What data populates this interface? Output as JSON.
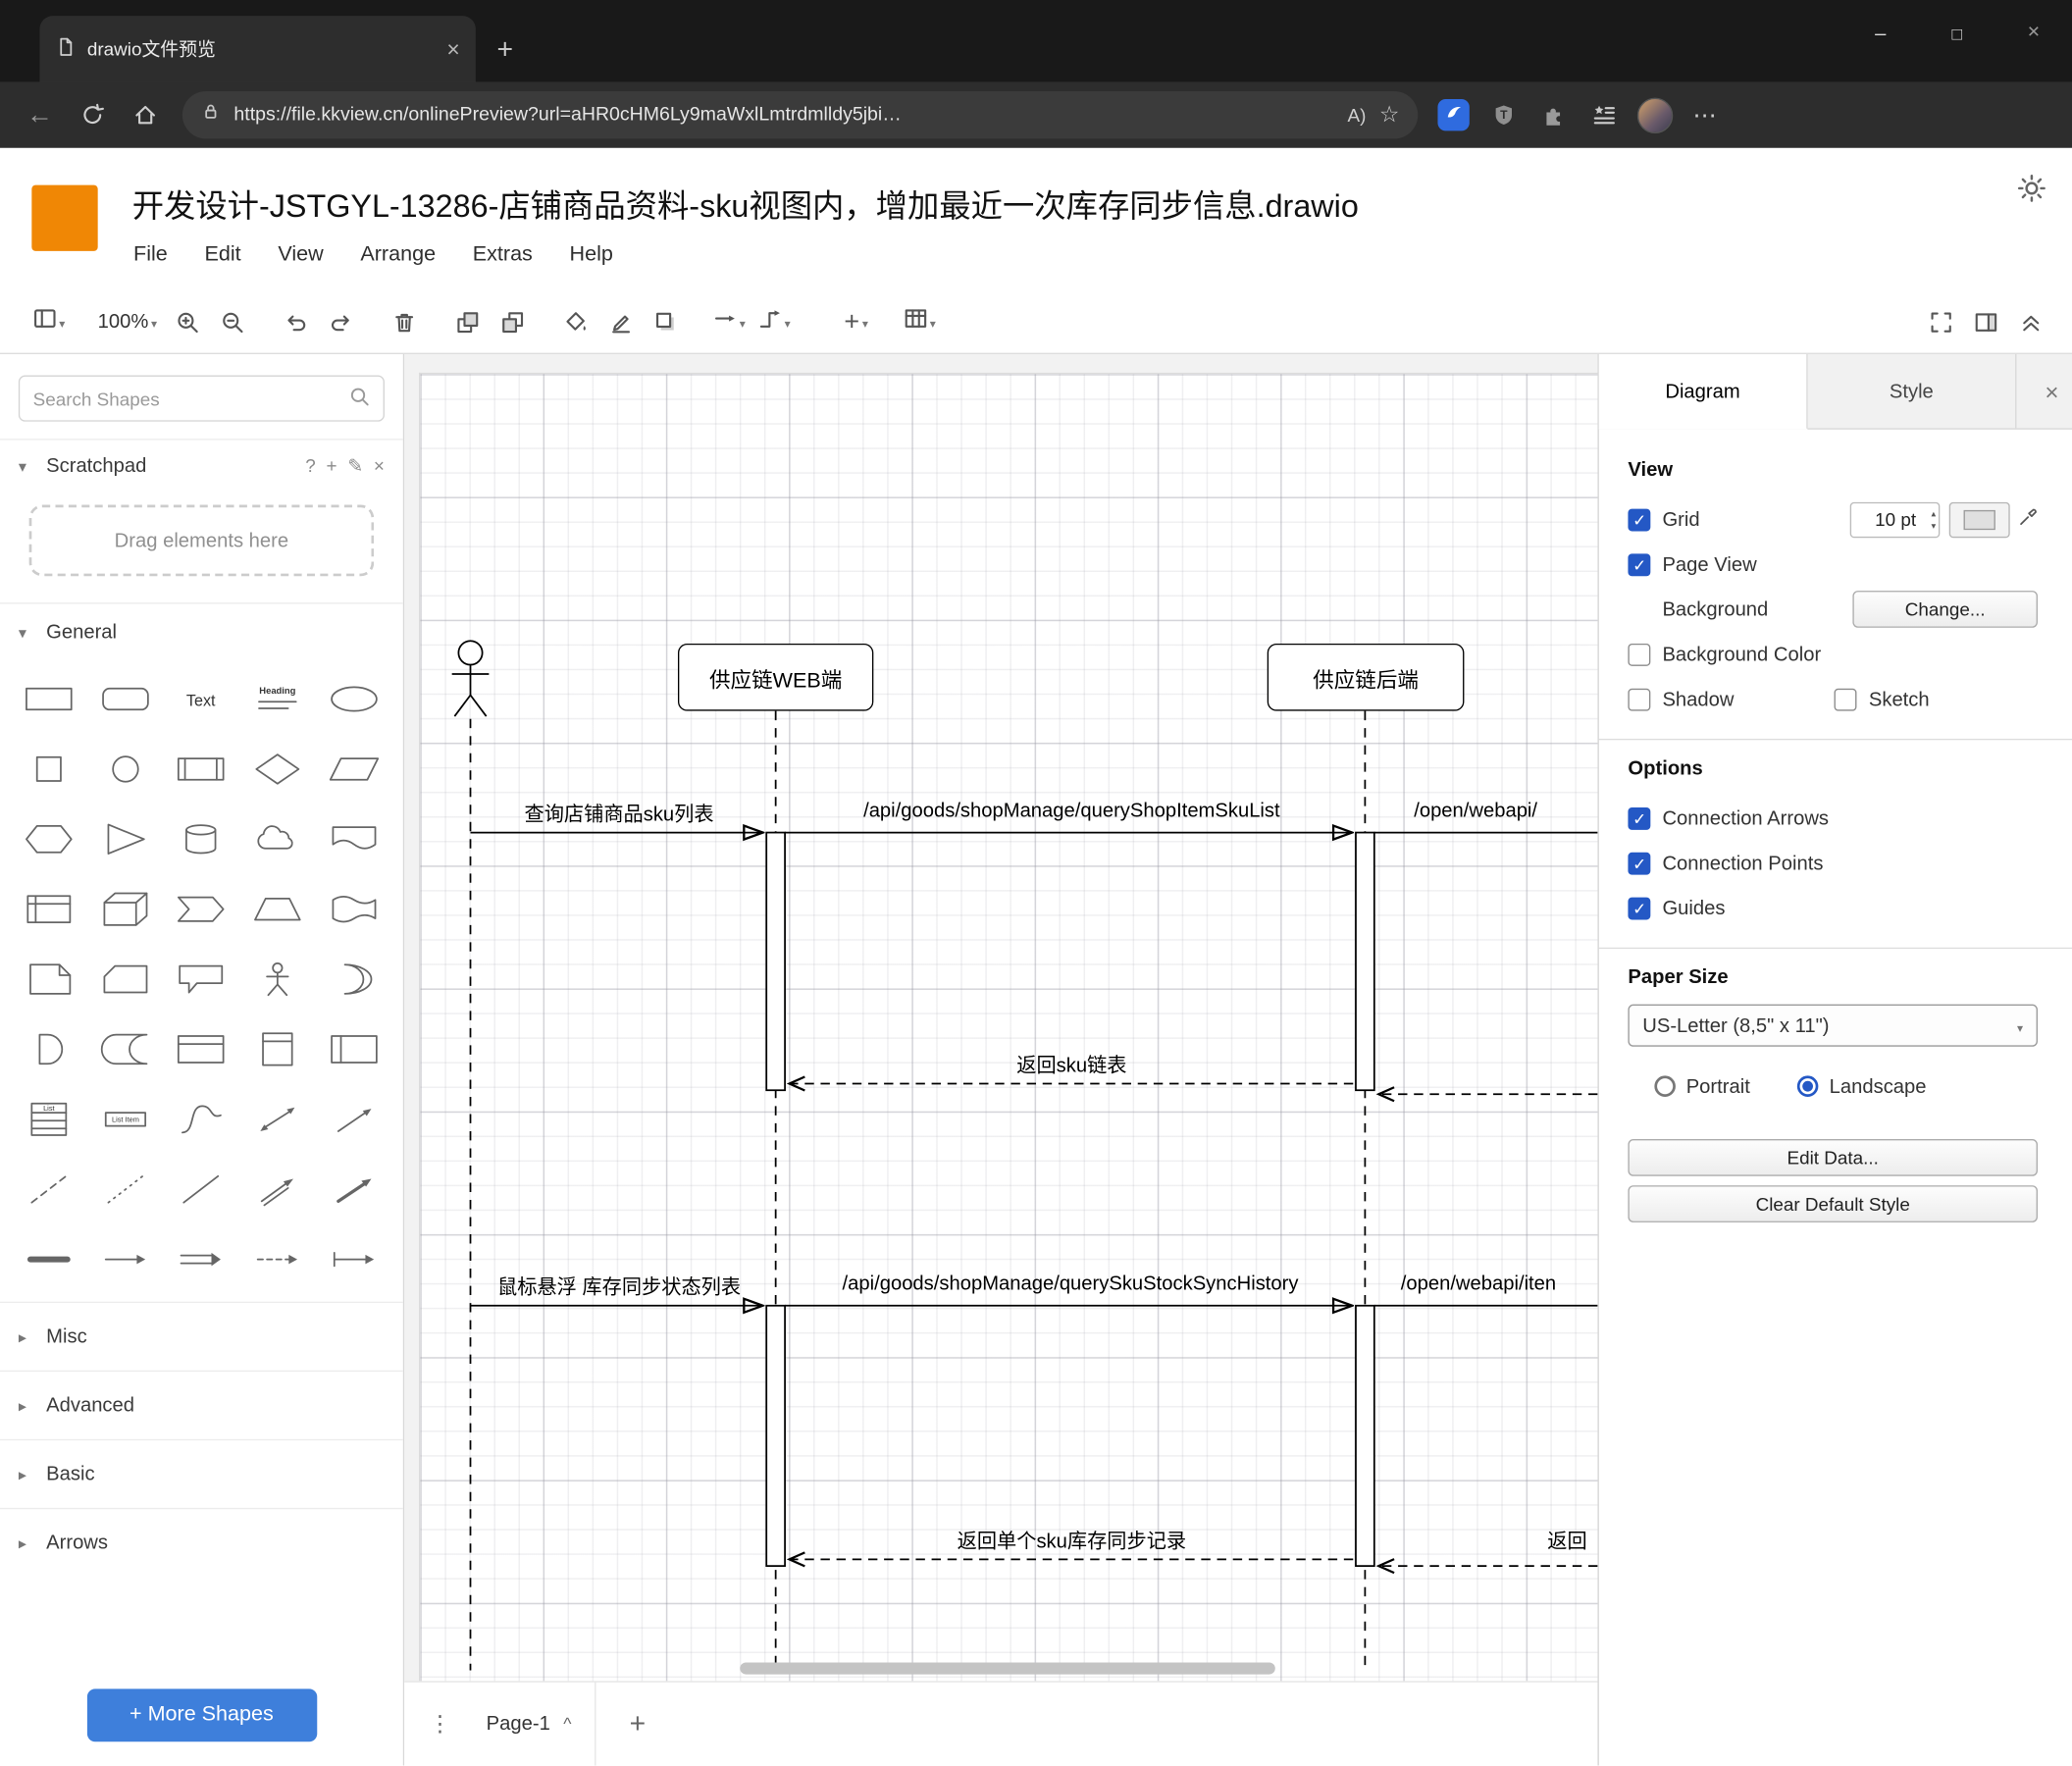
{
  "colors": {
    "drawio_orange": "#F08705",
    "more_shapes_blue": "#3E7FDB",
    "checkbox_blue": "#2458C5"
  },
  "browser": {
    "tab": {
      "title": "drawio文件预览"
    },
    "nav": {
      "url": "https://file.kkview.cn/onlinePreview?url=aHR0cHM6Ly9maWxlLmtrdmlldy5jbi…",
      "reader_label": "A)"
    }
  },
  "app": {
    "title": "开发设计-JSTGYL-13286-店铺商品资料-sku视图内，增加最近一次库存同步信息.drawio",
    "menus": [
      "File",
      "Edit",
      "View",
      "Arrange",
      "Extras",
      "Help"
    ],
    "toolbar": {
      "zoom": "100%"
    }
  },
  "sidebar": {
    "search_placeholder": "Search Shapes",
    "scratchpad_title": "Scratchpad",
    "scratchpad_hint": "Drag elements here",
    "sections": {
      "general": "General",
      "misc": "Misc",
      "advanced": "Advanced",
      "basic": "Basic",
      "arrows": "Arrows"
    },
    "more_shapes_label": "+ More Shapes",
    "shapes": [
      {
        "icon": "rectangle"
      },
      {
        "icon": "rounded-rectangle"
      },
      {
        "icon": "text",
        "label": "Text"
      },
      {
        "icon": "heading",
        "label": "Heading"
      },
      {
        "icon": "ellipse"
      },
      {
        "icon": "square"
      },
      {
        "icon": "circle"
      },
      {
        "icon": "process"
      },
      {
        "icon": "diamond"
      },
      {
        "icon": "parallelogram"
      },
      {
        "icon": "hexagon"
      },
      {
        "icon": "triangle"
      },
      {
        "icon": "cylinder"
      },
      {
        "icon": "cloud"
      },
      {
        "icon": "document"
      },
      {
        "icon": "internal-storage"
      },
      {
        "icon": "cube"
      },
      {
        "icon": "step"
      },
      {
        "icon": "trapezoid"
      },
      {
        "icon": "tape"
      },
      {
        "icon": "note"
      },
      {
        "icon": "card"
      },
      {
        "icon": "callout"
      },
      {
        "icon": "actor"
      },
      {
        "icon": "or"
      },
      {
        "icon": "and"
      },
      {
        "icon": "data-storage"
      },
      {
        "icon": "container"
      },
      {
        "icon": "vertical-container"
      },
      {
        "icon": "horizontal-container"
      },
      {
        "icon": "list",
        "label": "List"
      },
      {
        "icon": "list-item",
        "label": "List Item"
      },
      {
        "icon": "curve"
      },
      {
        "icon": "bidirectional-arrow"
      },
      {
        "icon": "arrow"
      },
      {
        "icon": "dashed-line"
      },
      {
        "icon": "dotted-line"
      },
      {
        "icon": "line"
      },
      {
        "icon": "double-arrow"
      },
      {
        "icon": "directional-arrow"
      },
      {
        "icon": "link"
      },
      {
        "icon": "arrow-h"
      },
      {
        "icon": "double-arrow-h"
      },
      {
        "icon": "dashed-arrow-h"
      },
      {
        "icon": "arrow-bar"
      }
    ]
  },
  "canvas": {
    "participants": [
      {
        "label": "供应链WEB端"
      },
      {
        "label": "供应链后端"
      }
    ],
    "messages": [
      {
        "label": "查询店铺商品sku列表"
      },
      {
        "label": "/api/goods/shopManage/queryShopItemSkuList"
      },
      {
        "label": "/open/webapi/"
      },
      {
        "label": "返回sku链表"
      },
      {
        "label": "鼠标悬浮 库存同步状态列表"
      },
      {
        "label": "/api/goods/shopManage/querySkuStockSyncHistory"
      },
      {
        "label": "/open/webapi/iten"
      },
      {
        "label": "返回单个sku库存同步记录"
      },
      {
        "label": "返回"
      }
    ],
    "page_tab": "Page-1"
  },
  "panel": {
    "tabs": {
      "diagram": "Diagram",
      "style": "Style"
    },
    "view": {
      "heading": "View",
      "grid": "Grid",
      "grid_size": "10 pt",
      "page_view": "Page View",
      "background": "Background",
      "change": "Change...",
      "background_color": "Background Color",
      "shadow": "Shadow",
      "sketch": "Sketch"
    },
    "options": {
      "heading": "Options",
      "connection_arrows": "Connection Arrows",
      "connection_points": "Connection Points",
      "guides": "Guides"
    },
    "paper": {
      "heading": "Paper Size",
      "size": "US-Letter (8,5\" x 11\")",
      "portrait": "Portrait",
      "landscape": "Landscape"
    },
    "actions": {
      "edit_data": "Edit Data...",
      "clear_default_style": "Clear Default Style"
    }
  }
}
